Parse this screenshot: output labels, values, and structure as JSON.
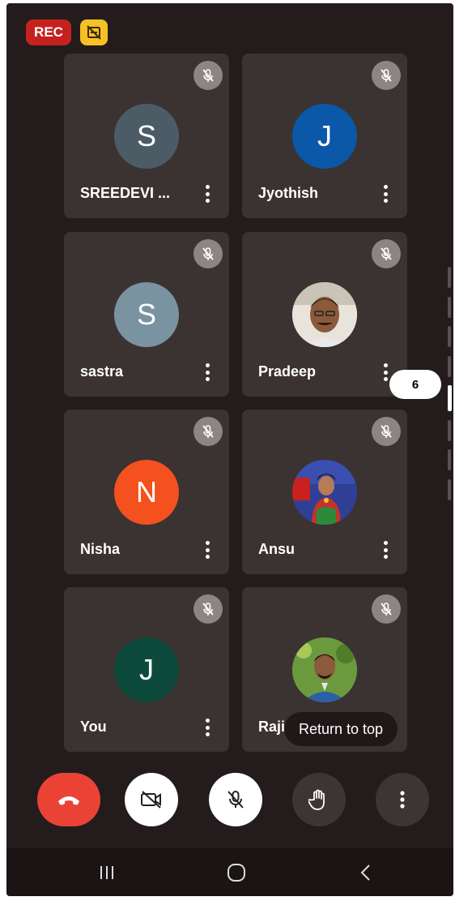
{
  "top_badges": {
    "rec_label": "REC",
    "nosub_icon": "no-captions-icon"
  },
  "tiles": [
    {
      "name": "SREEDEVI ...",
      "avatar_type": "letter",
      "letter": "S",
      "avatar_color": "#4b5c66",
      "muted": true
    },
    {
      "name": "Jyothish",
      "avatar_type": "letter",
      "letter": "J",
      "avatar_color": "#0b57a8",
      "muted": true
    },
    {
      "name": "sastra",
      "avatar_type": "letter",
      "letter": "S",
      "avatar_color": "#7a93a1",
      "muted": true
    },
    {
      "name": "Pradeep",
      "avatar_type": "photo",
      "muted": true
    },
    {
      "name": "Nisha",
      "avatar_type": "letter",
      "letter": "N",
      "avatar_color": "#f4511e",
      "muted": true
    },
    {
      "name": "Ansu",
      "avatar_type": "photo",
      "muted": true
    },
    {
      "name": "You",
      "avatar_type": "letter",
      "letter": "J",
      "avatar_color": "#0d4a3c",
      "muted": true
    },
    {
      "name": "Raji",
      "avatar_type": "photo",
      "muted": true
    }
  ],
  "scroll": {
    "page_bubble": "6"
  },
  "return_to_top": "Return to top",
  "controls": {
    "end_call_icon": "phone-hangup-icon",
    "camera_icon": "camera-off-icon",
    "mic_icon": "mic-off-icon",
    "hand_icon": "raise-hand-icon",
    "more_icon": "more-vert-icon"
  },
  "colors": {
    "background": "#241c1c",
    "tile": "#3b3232",
    "end_call": "#ea4335",
    "rec": "#c5221f",
    "badge_yellow": "#f6c026"
  }
}
